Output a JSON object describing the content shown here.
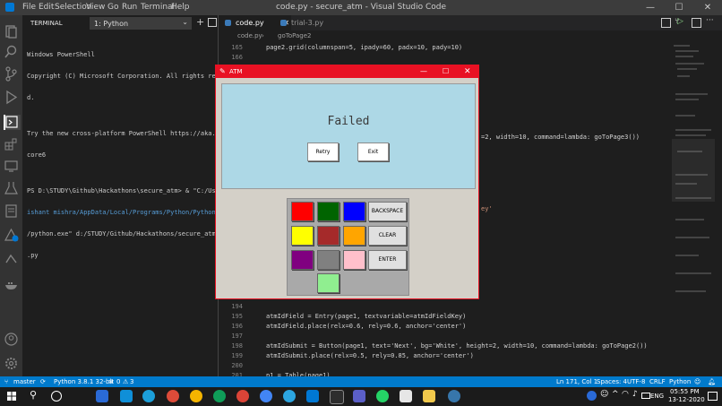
{
  "app": {
    "window_title": "code.py - secure_atm - Visual Studio Code",
    "menu": [
      "File",
      "Edit",
      "Selection",
      "View",
      "Go",
      "Run",
      "Terminal",
      "Help"
    ]
  },
  "terminal": {
    "tab_label": "TERMINAL",
    "shell_select": "1: Python",
    "lines": [
      "Windows PowerShell",
      "Copyright (C) Microsoft Corporation. All rights reserve",
      "d.",
      "",
      "Try the new cross-platform PowerShell https://aka.ms/ps",
      "core6",
      "",
      "PS D:\\STUDY\\Github\\Hackathons\\secure_atm> & \"C:/Users/n",
      "ishant mishra/AppData/Local/Programs/Python/Python38-32",
      "/python.exe\" d:/STUDY/Github/Hackathons/secure_atm/code",
      ".py"
    ]
  },
  "editor": {
    "tabs": [
      {
        "label": "code.py",
        "active": true
      },
      {
        "label": "trial-3.py",
        "active": false
      }
    ],
    "breadcrumb": [
      "code.py",
      "goToPage2"
    ],
    "top_lines": [
      {
        "n": "165",
        "code": "page2.grid(columnspan=5, ipady=60, padx=10, pady=10)"
      },
      {
        "n": "166",
        "code": ""
      }
    ],
    "side_fragments": [
      {
        "code": "=2, width=10, command=lambda: goToPage3())"
      },
      {
        "code": "ey'"
      }
    ],
    "bottom_lines": [
      {
        "n": "194",
        "code": ""
      },
      {
        "n": "195",
        "code": "atmIdField = Entry(page1, textvariable=atmIdFieldKey)"
      },
      {
        "n": "196",
        "code": "atmIdField.place(relx=0.6, rely=0.6, anchor='center')"
      },
      {
        "n": "197",
        "code": ""
      },
      {
        "n": "198",
        "code": "atmIdSubmit = Button(page1, text='Next', bg='White', height=2, width=10, command=lambda: goToPage2())"
      },
      {
        "n": "199",
        "code": "atmIdSubmit.place(relx=0.5, rely=0.85, anchor='center')"
      },
      {
        "n": "200",
        "code": ""
      },
      {
        "n": "201",
        "code": "p1 = Table(page1)"
      },
      {
        "n": "202",
        "code": ""
      }
    ]
  },
  "statusbar": {
    "branch": "master",
    "interpreter": "Python 3.8.1 32-bit",
    "errors": "0",
    "warnings": "3",
    "position": "Ln 171, Col 1",
    "spaces": "Spaces: 4",
    "encoding": "UTF-8",
    "eol": "CRLF",
    "language": "Python"
  },
  "atm_window": {
    "title": "ATM",
    "message": "Failed",
    "retry_label": "Retry",
    "exit_label": "Exit",
    "keypad": {
      "colors": [
        "#ff0000",
        "#006400",
        "#0000ff",
        "#ffff00",
        "#a52a2a",
        "#ffa500",
        "#800080",
        "#808080",
        "#ffc0cb",
        "#90ee90"
      ],
      "backspace_label": "BACKSPACE",
      "clear_label": "CLEAR",
      "enter_label": "ENTER"
    }
  },
  "taskbar": {
    "time": "05:55 PM",
    "date": "13-12-2020",
    "language": "ENG"
  }
}
